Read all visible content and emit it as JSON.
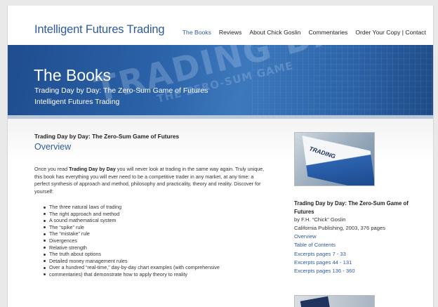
{
  "header": {
    "site_title": "Intelligent Futures Trading",
    "nav": [
      "The Books",
      "Reviews",
      "About Chick Goslin",
      "Commentaries",
      "Order Your Copy | Contact"
    ]
  },
  "banner": {
    "title": "The Books",
    "subtitle_1": "Trading Day by Day: The Zero-Sum Game of Futures",
    "subtitle_2": "Intelligent Futures Trading",
    "decor_text_1": "TRADING DA",
    "decor_text_2": "THE ZERO-SUM GAME"
  },
  "main": {
    "book_heading": "Trading Day by Day: The Zero-Sum Game of Futures",
    "section_title": "Overview",
    "intro_prefix": "Once you read ",
    "intro_bold": "Trading Day by Day",
    "intro_suffix": " you will never look at trading in the same way again. Truly unique, this book has everything you will ever need to be a competitive trader in any market, at any time: a perfect synthesis of approach and method, philosophy and practicality, theory and reality. Discover for yourself:",
    "bullets": [
      "The three natural laws of trading",
      "The right approach and method",
      "A sound mathematical system",
      "The “spike” rule",
      "The “mistake” rule",
      "Divergences",
      "Relative strength",
      "The truth about options",
      "Detailed money management rules",
      "Over a hundred “real-time,” day-by-day chart examples (with comprehensive",
      "commentaries) that demonstrate how to apply theory to reality"
    ]
  },
  "sidebar": {
    "cover_text": "TRADING",
    "title": "Trading Day by Day: The Zero-Sum Game of Futures",
    "author": "by F.H. “Chick” Goslin",
    "publisher": "California Publishing, 2003, 376 pages",
    "links": [
      "Overview",
      "Table of Contents",
      "Excerpts pages 7 - 33",
      "Excerpts pages 44 - 131",
      "Excerpts pages 136 - 360"
    ]
  },
  "colors": {
    "brand_blue": "#2e5a9c",
    "banner_blue": "#2b62a8"
  }
}
